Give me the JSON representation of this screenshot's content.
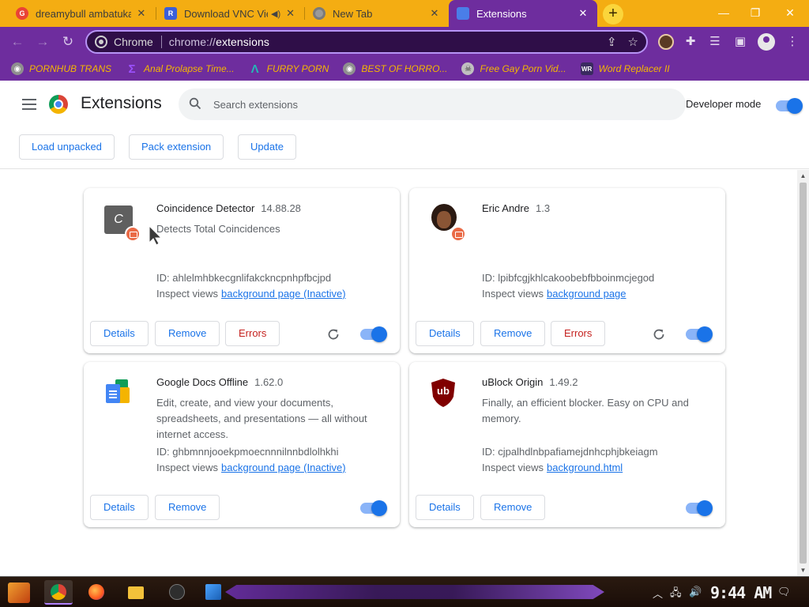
{
  "browser": {
    "tabs": [
      {
        "title": "dreamybull ambatukam",
        "favicon_color": "#ea4335",
        "favicon_char": "G"
      },
      {
        "title": "Download VNC Viewer",
        "favicon_color": "#3b5fd8",
        "favicon_char": "R"
      },
      {
        "title": "New Tab",
        "favicon_color": "#9a9a9a",
        "favicon_char": ""
      },
      {
        "title": "Extensions",
        "favicon_color": "#4a7ee8",
        "favicon_char": ""
      }
    ],
    "url_scheme": "chrome://",
    "url_path": "extensions",
    "site_chip": "Chrome"
  },
  "bookmarks": [
    {
      "label": "PORNHUB TRANS",
      "icon_color": "#8f8f8f",
      "icon": "globe-icon"
    },
    {
      "label": "Anal Prolapse Time...",
      "icon_color": "#9c51ff",
      "icon": "sigma-icon"
    },
    {
      "label": "FURRY PORN",
      "icon_color": "#25b6b6",
      "icon": "lambda-icon"
    },
    {
      "label": "BEST OF HORRO...",
      "icon_color": "#8f8f8f",
      "icon": "globe-icon"
    },
    {
      "label": "Free Gay Porn Vid...",
      "icon_color": "#c0c0c0",
      "icon": "skull-icon"
    },
    {
      "label": "Word Replacer II",
      "icon_color": "#6b2fc0",
      "icon": "wr-icon"
    }
  ],
  "header": {
    "title": "Extensions",
    "search_placeholder": "Search extensions",
    "dev_mode_label": "Developer mode",
    "dev_mode_on": true,
    "buttons": {
      "load_unpacked": "Load unpacked",
      "pack_extension": "Pack extension",
      "update": "Update"
    }
  },
  "labels": {
    "id_prefix": "ID: ",
    "inspect_views": "Inspect views",
    "details": "Details",
    "remove": "Remove",
    "errors": "Errors"
  },
  "extensions": [
    {
      "name": "Coincidence Detector",
      "version": "14.88.28",
      "description": "Detects Total Coincidences",
      "id": "ahlelmhbkecgnlifakckncpnhpfbcjpd",
      "inspect_link": "background page (Inactive)",
      "enabled": true,
      "icon_letter": "C"
    },
    {
      "name": "Eric Andre",
      "version": "1.3",
      "description": "",
      "id": "lpibfcgjkhlcakoobebfbboinmcjegod",
      "inspect_link": "background page",
      "enabled": true
    },
    {
      "name": "Google Docs Offline",
      "version": "1.62.0",
      "description": "Edit, create, and view your documents, spreadsheets, and presentations — all without internet access.",
      "id": "ghbmnnjooekpmoecnnnilnnbdlolhkhi",
      "inspect_link": "background page (Inactive)",
      "enabled": true
    },
    {
      "name": "uBlock Origin",
      "version": "1.49.2",
      "description": "Finally, an efficient blocker. Easy on CPU and memory.",
      "id": "cjpalhdlnbpafiamejdnhcphjbkeiagm",
      "inspect_link": "background.html",
      "enabled": true,
      "icon_text": "ub"
    }
  ],
  "taskbar": {
    "clock": "9:44 AM"
  }
}
